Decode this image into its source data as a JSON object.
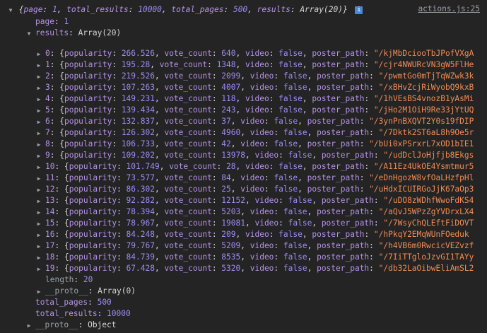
{
  "source_link": "actions.js:25",
  "summary": {
    "prefix": "{",
    "fields": [
      {
        "key": "page",
        "value": "1"
      },
      {
        "key": "total_results",
        "value": "10000"
      },
      {
        "key": "total_pages",
        "value": "500"
      },
      {
        "key": "results",
        "value": "Array(20)"
      }
    ],
    "suffix": "}",
    "info_icon": "i"
  },
  "page_line": {
    "key": "page",
    "value": "1"
  },
  "results_line": {
    "key": "results",
    "value": "Array(20)"
  },
  "results": [
    {
      "idx": "0",
      "popularity": "266.526",
      "vote_count": "640",
      "poster_path": "\"/kjMbDciooTbJPofVXgA"
    },
    {
      "idx": "1",
      "popularity": "195.28",
      "vote_count": "1348",
      "poster_path": "\"/cjr4NWURcVN3gW5FlHe"
    },
    {
      "idx": "2",
      "popularity": "219.526",
      "vote_count": "2099",
      "poster_path": "\"/pwmtGo0mTjTqWZwk3k"
    },
    {
      "idx": "3",
      "popularity": "107.263",
      "vote_count": "4007",
      "poster_path": "\"/xBHvZcjRiWyobQ9kxB"
    },
    {
      "idx": "4",
      "popularity": "149.231",
      "vote_count": "118",
      "poster_path": "\"/1hVEsBS4vnozB1yAsMi"
    },
    {
      "idx": "5",
      "popularity": "139.434",
      "vote_count": "243",
      "poster_path": "\"/jHo2M1OiH9Re33jYtUQ"
    },
    {
      "idx": "6",
      "popularity": "132.837",
      "vote_count": "37",
      "poster_path": "\"/3ynPnBXQVT2Y0s19fDIP"
    },
    {
      "idx": "7",
      "popularity": "126.302",
      "vote_count": "4960",
      "poster_path": "\"/7Dktk2ST6aL8h9Oe5r"
    },
    {
      "idx": "8",
      "popularity": "106.733",
      "vote_count": "42",
      "poster_path": "\"/bUi0xPSrxrL7xOD1bIE1"
    },
    {
      "idx": "9",
      "popularity": "109.202",
      "vote_count": "13978",
      "poster_path": "\"/udDclJoHjfjb8Ekgs"
    },
    {
      "idx": "10",
      "popularity": "101.749",
      "vote_count": "28",
      "poster_path": "\"/A11Ez4UkOE4Ysmtmur5"
    },
    {
      "idx": "11",
      "popularity": "73.577",
      "vote_count": "84",
      "poster_path": "\"/eDnHgozW8vfOaLHzfpHl"
    },
    {
      "idx": "12",
      "popularity": "86.302",
      "vote_count": "25",
      "poster_path": "\"/uHdxICUIRGoJjK67aOp3"
    },
    {
      "idx": "13",
      "popularity": "92.282",
      "vote_count": "12152",
      "poster_path": "\"/uDO8zWDhfWwoFdKS4"
    },
    {
      "idx": "14",
      "popularity": "78.394",
      "vote_count": "5203",
      "poster_path": "\"/aQvJ5WPzZgYVDrxLX4"
    },
    {
      "idx": "15",
      "popularity": "78.967",
      "vote_count": "19081",
      "poster_path": "\"/7WsyChQLEftFiDOVT"
    },
    {
      "idx": "16",
      "popularity": "84.248",
      "vote_count": "209",
      "poster_path": "\"/hPkqY2EMqWUnFOeduk"
    },
    {
      "idx": "17",
      "popularity": "79.767",
      "vote_count": "5209",
      "poster_path": "\"/h4VB6m0RwcicVEZvzf"
    },
    {
      "idx": "18",
      "popularity": "84.739",
      "vote_count": "8535",
      "poster_path": "\"/7IiTTgloJzvGI1TAYy"
    },
    {
      "idx": "19",
      "popularity": "67.428",
      "vote_count": "5320",
      "poster_path": "\"/db32LaOibwEliAmSL2"
    }
  ],
  "result_labels": {
    "popularity": "popularity",
    "vote_count": "vote_count",
    "video": "video",
    "video_value": "false",
    "poster_path": "poster_path"
  },
  "length_line": {
    "key": "length",
    "value": "20"
  },
  "proto_array": {
    "key": "__proto__",
    "value": "Array(0)"
  },
  "total_pages_line": {
    "key": "total_pages",
    "value": "500"
  },
  "total_results_line": {
    "key": "total_results",
    "value": "10000"
  },
  "proto_object": {
    "key": "__proto__",
    "value": "Object"
  }
}
